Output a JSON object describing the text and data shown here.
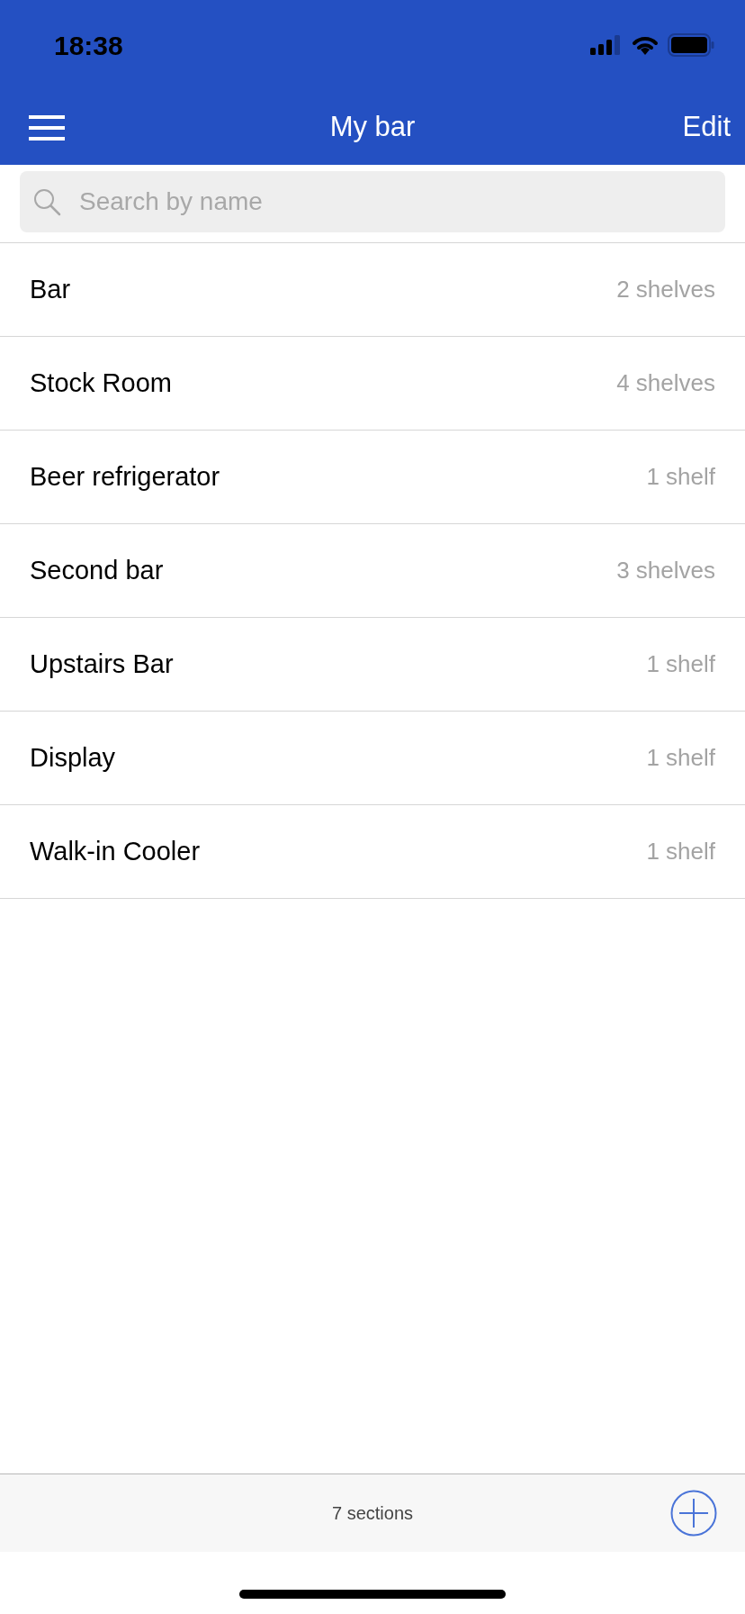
{
  "status_bar": {
    "time": "18:38"
  },
  "nav_bar": {
    "title": "My bar",
    "edit": "Edit"
  },
  "search": {
    "placeholder": "Search by name"
  },
  "sections": [
    {
      "name": "Bar",
      "count": "2 shelves"
    },
    {
      "name": "Stock Room",
      "count": "4 shelves"
    },
    {
      "name": "Beer refrigerator",
      "count": "1 shelf"
    },
    {
      "name": "Second bar",
      "count": "3 shelves"
    },
    {
      "name": "Upstairs Bar",
      "count": "1 shelf"
    },
    {
      "name": "Display",
      "count": "1 shelf"
    },
    {
      "name": "Walk-in Cooler",
      "count": "1 shelf"
    }
  ],
  "footer": {
    "summary": "7 sections"
  }
}
